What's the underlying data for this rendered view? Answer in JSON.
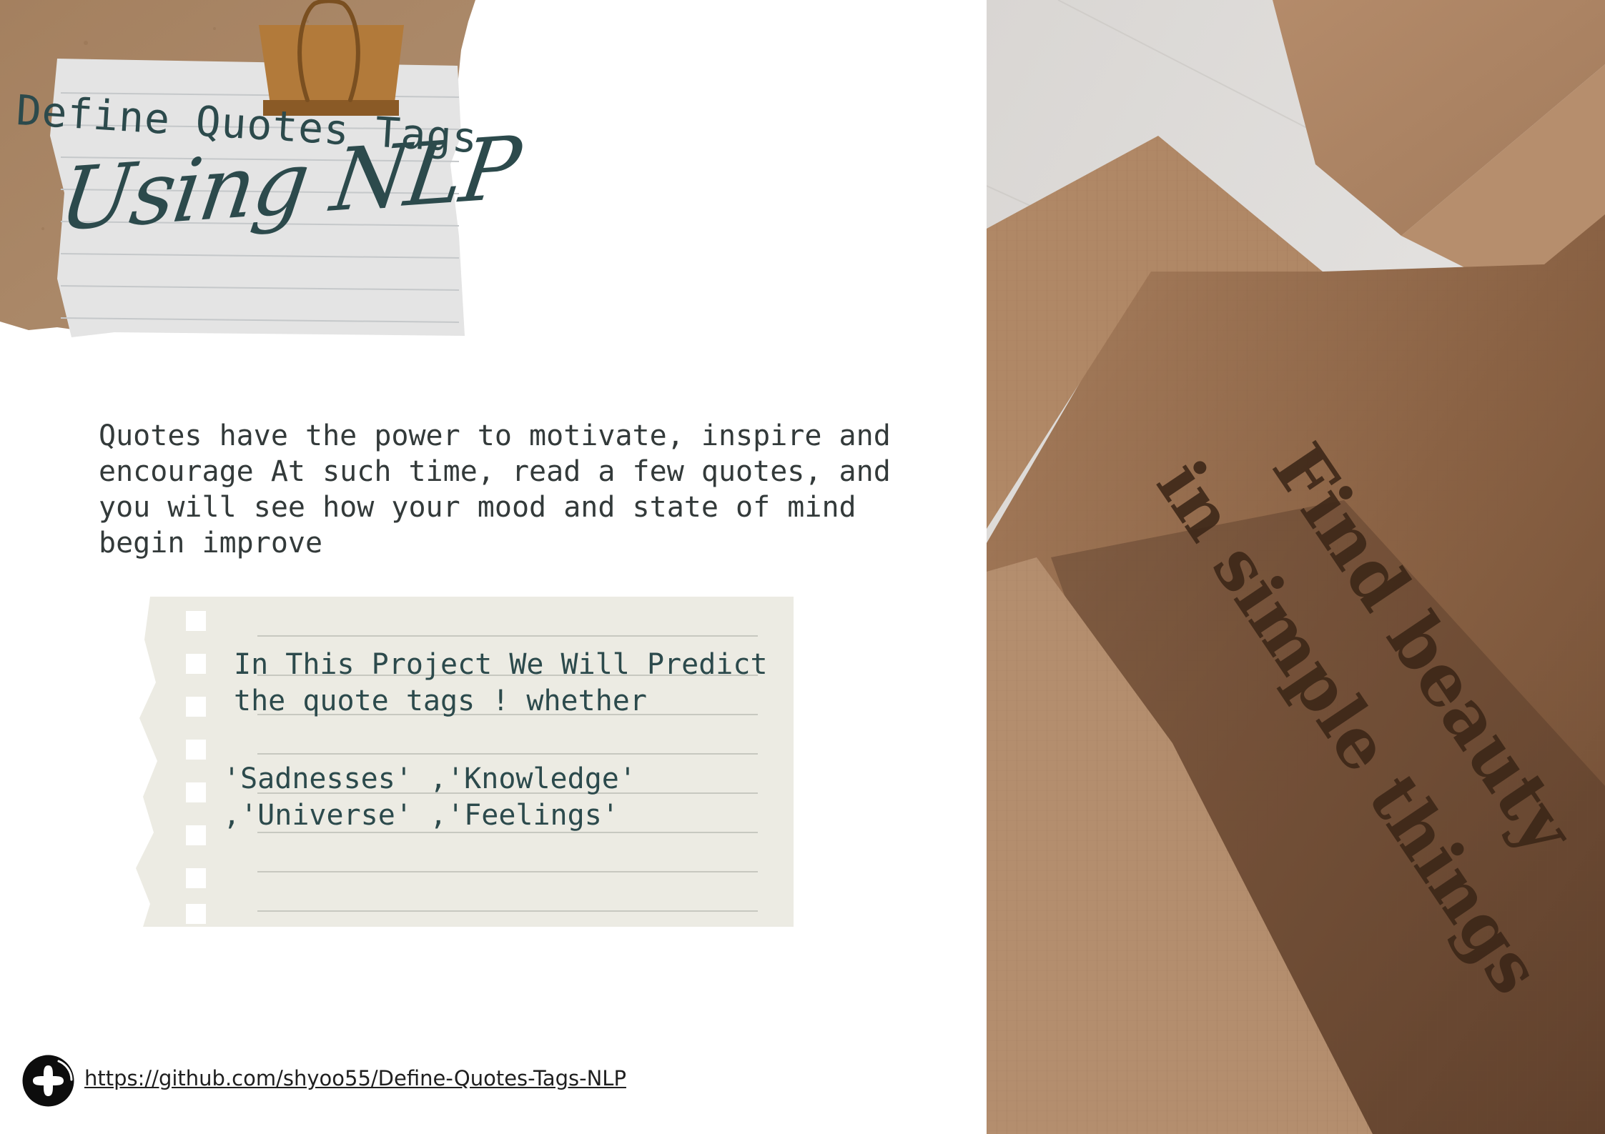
{
  "header": {
    "title": "Define Quotes Tags",
    "subtitle": "Using NLP"
  },
  "intro": {
    "text": "Quotes have the power to motivate, inspire and encourage At such time, read a few quotes, and you will see how your mood and state of mind begin improve"
  },
  "note": {
    "line1": "In This Project We Will  Predict the quote tags ! whether",
    "line2": "'Sadnesses' ,'Knowledge' ,'Universe' ,'Feelings'"
  },
  "footer": {
    "link_text": "https://github.com/shyoo55/Define-Quotes-Tags-NLP",
    "icon": "plus-circle-icon"
  },
  "photo": {
    "line1": "Find beauty",
    "line2": "in simple things"
  },
  "colors": {
    "ink": "#2c4a4c",
    "kraft": "#a98566",
    "clip": "#b27a3a",
    "paper": "#e6e6e6",
    "note_paper": "#ecebe3"
  }
}
